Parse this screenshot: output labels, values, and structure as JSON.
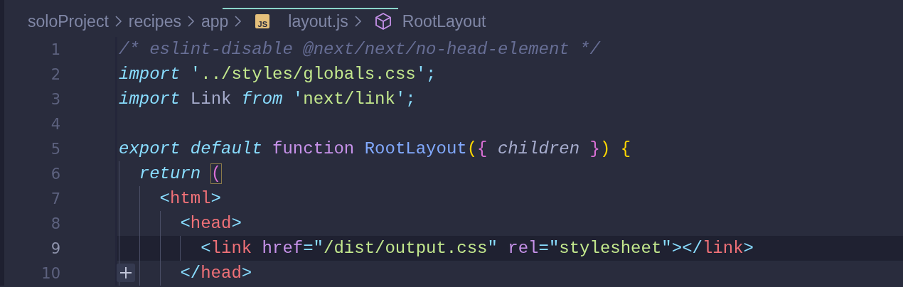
{
  "breadcrumb": [
    {
      "kind": "folder",
      "text": "soloProject"
    },
    {
      "kind": "folder",
      "text": "recipes"
    },
    {
      "kind": "folder",
      "text": "app"
    },
    {
      "kind": "file",
      "icon_label": "JS",
      "text": "layout.js"
    },
    {
      "kind": "symbol",
      "text": "RootLayout"
    }
  ],
  "lines": [
    {
      "number": "1",
      "active": false,
      "tokens": [
        {
          "kind": "comment",
          "text": "/* eslint-disable @next/next/no-head-element */"
        }
      ]
    },
    {
      "number": "2",
      "active": false,
      "tokens": [
        {
          "kind": "keyword",
          "text": "import"
        },
        {
          "kind": "punct",
          "text": " '"
        },
        {
          "kind": "string",
          "text": "../styles/globals.css"
        },
        {
          "kind": "punct",
          "text": "';"
        }
      ]
    },
    {
      "number": "3",
      "active": false,
      "tokens": [
        {
          "kind": "keyword",
          "text": "import"
        },
        {
          "kind": "plain",
          "text": " Link "
        },
        {
          "kind": "keyword",
          "text": "from"
        },
        {
          "kind": "punct",
          "text": " '"
        },
        {
          "kind": "string",
          "text": "next/link"
        },
        {
          "kind": "punct",
          "text": "';"
        }
      ]
    },
    {
      "number": "4",
      "active": false
    },
    {
      "number": "5",
      "active": false,
      "tokens": [
        {
          "kind": "keyword",
          "text": "export default"
        },
        {
          "kind": "storage",
          "text": " function"
        },
        {
          "kind": "function",
          "text": " RootLayout"
        },
        {
          "kind": "bracket",
          "text": "("
        },
        {
          "kind": "bracket2",
          "text": "{"
        },
        {
          "kind": "param",
          "text": " children "
        },
        {
          "kind": "bracket2",
          "text": "}"
        },
        {
          "kind": "bracket",
          "text": ") {"
        }
      ]
    },
    {
      "number": "6",
      "active": false,
      "tokens": [
        {
          "kind": "keyword",
          "text": "  return "
        },
        {
          "kind": "bracket-match",
          "text": "("
        }
      ]
    },
    {
      "number": "7",
      "active": false,
      "tokens": [
        {
          "kind": "punct",
          "text": "    <"
        },
        {
          "kind": "tag",
          "text": "html"
        },
        {
          "kind": "punct",
          "text": ">"
        }
      ]
    },
    {
      "number": "8",
      "active": false,
      "tokens": [
        {
          "kind": "punct",
          "text": "      <"
        },
        {
          "kind": "tag",
          "text": "head"
        },
        {
          "kind": "punct",
          "text": ">"
        }
      ]
    },
    {
      "number": "9",
      "active": true,
      "tokens": [
        {
          "kind": "punct",
          "text": "        <"
        },
        {
          "kind": "tag",
          "text": "link"
        },
        {
          "kind": "attr",
          "text": " href"
        },
        {
          "kind": "punct",
          "text": "=\""
        },
        {
          "kind": "string",
          "text": "/dist/output.css"
        },
        {
          "kind": "punct",
          "text": "\""
        },
        {
          "kind": "attr",
          "text": " rel"
        },
        {
          "kind": "punct",
          "text": "=\""
        },
        {
          "kind": "string",
          "text": "stylesheet"
        },
        {
          "kind": "punct",
          "text": "\"></"
        },
        {
          "kind": "tag",
          "text": "link"
        },
        {
          "kind": "punct",
          "text": ">"
        }
      ]
    },
    {
      "number": "10",
      "active": false,
      "tokens": [
        {
          "kind": "punct",
          "text": "      </"
        },
        {
          "kind": "tag",
          "text": "head"
        },
        {
          "kind": "punct",
          "text": ">"
        }
      ]
    }
  ]
}
